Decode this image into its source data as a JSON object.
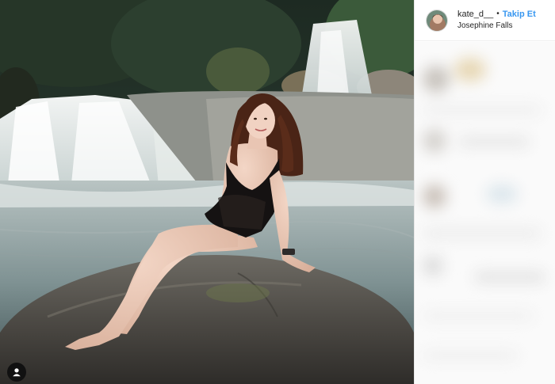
{
  "post": {
    "username": "kate_d__",
    "separator": "•",
    "follow_label": "Takip Et",
    "location": "Josephine Falls"
  },
  "photo": {
    "subject": "woman in black swimsuit sitting on a boulder by a waterfall",
    "tag_icon": "user-tag-icon"
  },
  "colors": {
    "follow_blue": "#3897f0",
    "text_dark": "#262626",
    "border": "#efefef"
  }
}
